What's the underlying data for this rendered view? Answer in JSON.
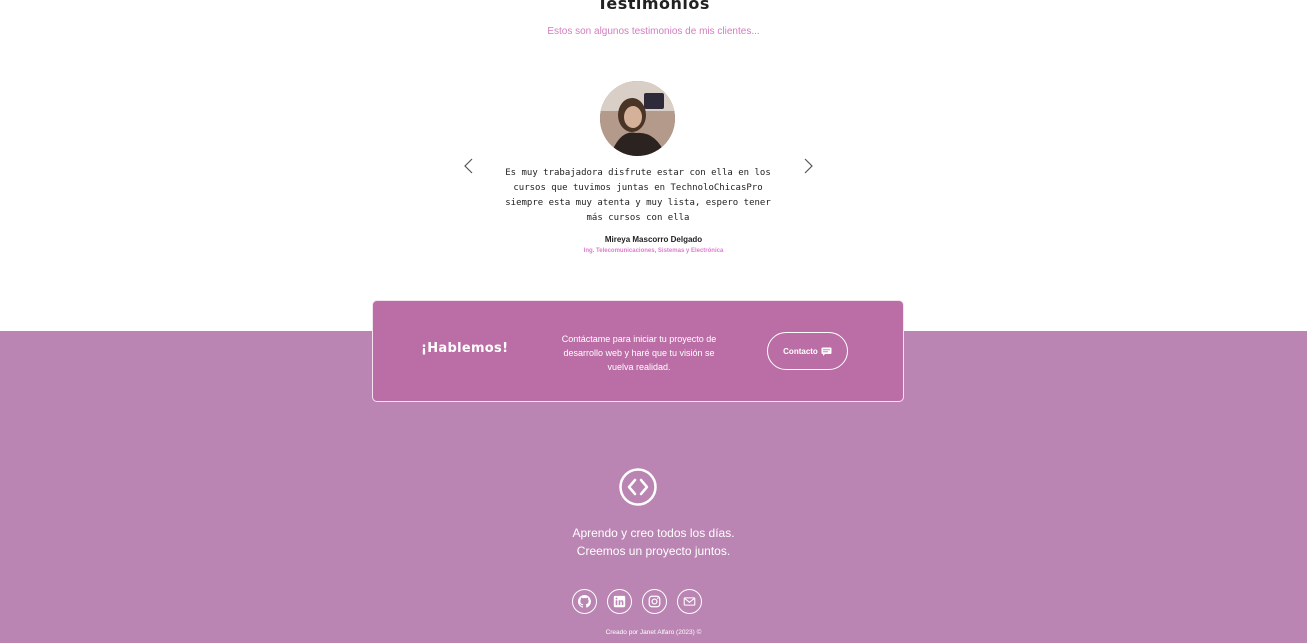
{
  "testimonials": {
    "title": "Testimonios",
    "subtitle": "Estos son algunos testimonios de mis clientes...",
    "quote": "Es muy trabajadora disfrute estar con ella en los cursos que tuvimos juntas en TechnoloChicasPro siempre esta muy atenta y muy lista, espero tener más cursos con ella",
    "author": "Mireya Mascorro Delgado",
    "role": "Ing. Telecomunicaciones, Sistemas y Electrónica",
    "prev_icon": "chevron-left-icon",
    "next_icon": "chevron-right-icon"
  },
  "cta": {
    "title": "¡Hablemos!",
    "text": "Contáctame para iniciar tu proyecto de desarrollo web y haré que tu visión se vuelva realidad.",
    "button_label": "Contacto",
    "button_icon": "chat-icon"
  },
  "footer": {
    "logo_icon": "code-brackets-icon",
    "tagline_line1": "Aprendo y creo todos los días.",
    "tagline_line2": "Creemos un proyecto juntos.",
    "socials": [
      {
        "icon": "github-icon"
      },
      {
        "icon": "linkedin-icon"
      },
      {
        "icon": "instagram-icon"
      },
      {
        "icon": "email-icon"
      }
    ],
    "credit": "Creado por Janet Alfaro (2023) ©"
  },
  "colors": {
    "footer_bg": "#bb85b3",
    "cta_bg": "#bb6ea6",
    "accent_pink": "#d47bc0"
  }
}
